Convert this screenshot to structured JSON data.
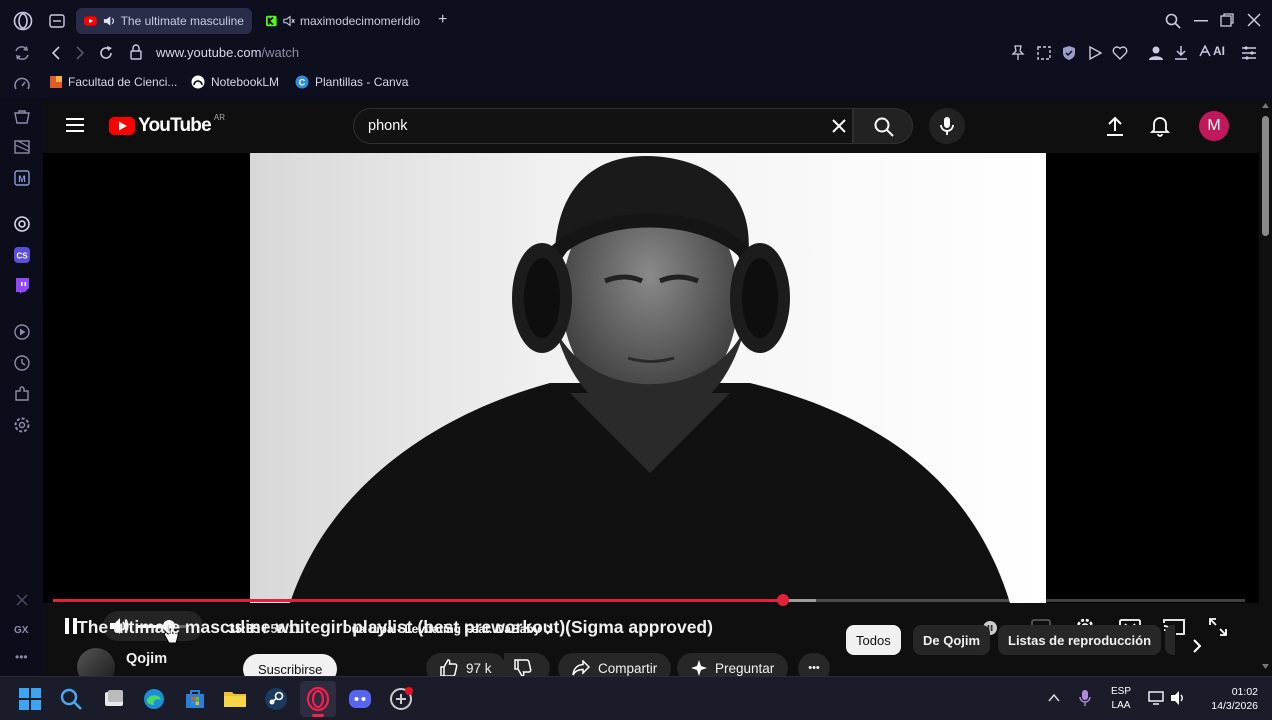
{
  "browser": {
    "tabs": [
      {
        "label": "The ultimate masculine",
        "active": true
      },
      {
        "label": "maximodecimomeridio",
        "active": false
      }
    ],
    "new_tab": "+",
    "url_host": "www.youtube.com",
    "url_path": "/watch",
    "ai_label": "AI",
    "bookmarks": [
      {
        "label": "Facultad de Cienci..."
      },
      {
        "label": "NotebookLM"
      },
      {
        "label": "Plantillas - Canva"
      }
    ],
    "sidebar_gx": "GX"
  },
  "youtube": {
    "logo_text": "YouTube",
    "logo_region": "AR",
    "search_value": "phonk",
    "avatar_letter": "M",
    "player": {
      "current_time": "35:35",
      "separator": "/",
      "duration": "58:11",
      "chapter": "Dua Lipa - Levitating Feat. DaBaby",
      "progress_fraction": 0.612,
      "buffer_fraction": 0.64,
      "volume_fraction": 0.62
    },
    "video_title": "The ultimate masculine whitegirl playlist (best preworkout)(Sigma approved)",
    "channel_name": "Qojim",
    "subscribe_label": "Suscribirse",
    "like_count": "97 k",
    "share_label": "Compartir",
    "ask_label": "Preguntar",
    "more_label": "•••",
    "chips": [
      {
        "label": "Todos",
        "selected": true
      },
      {
        "label": "De Qojim",
        "selected": false
      },
      {
        "label": "Listas de reproducción",
        "selected": false
      }
    ]
  },
  "taskbar": {
    "lang_top": "ESP",
    "lang_bottom": "LAA",
    "time": "01:02",
    "date": "14/3/2026"
  },
  "colors": {
    "yt_red": "#e0223b",
    "browser_bg": "#0d0f1f",
    "yt_bg": "#0f0f0f",
    "avatar": "#c2185b"
  }
}
